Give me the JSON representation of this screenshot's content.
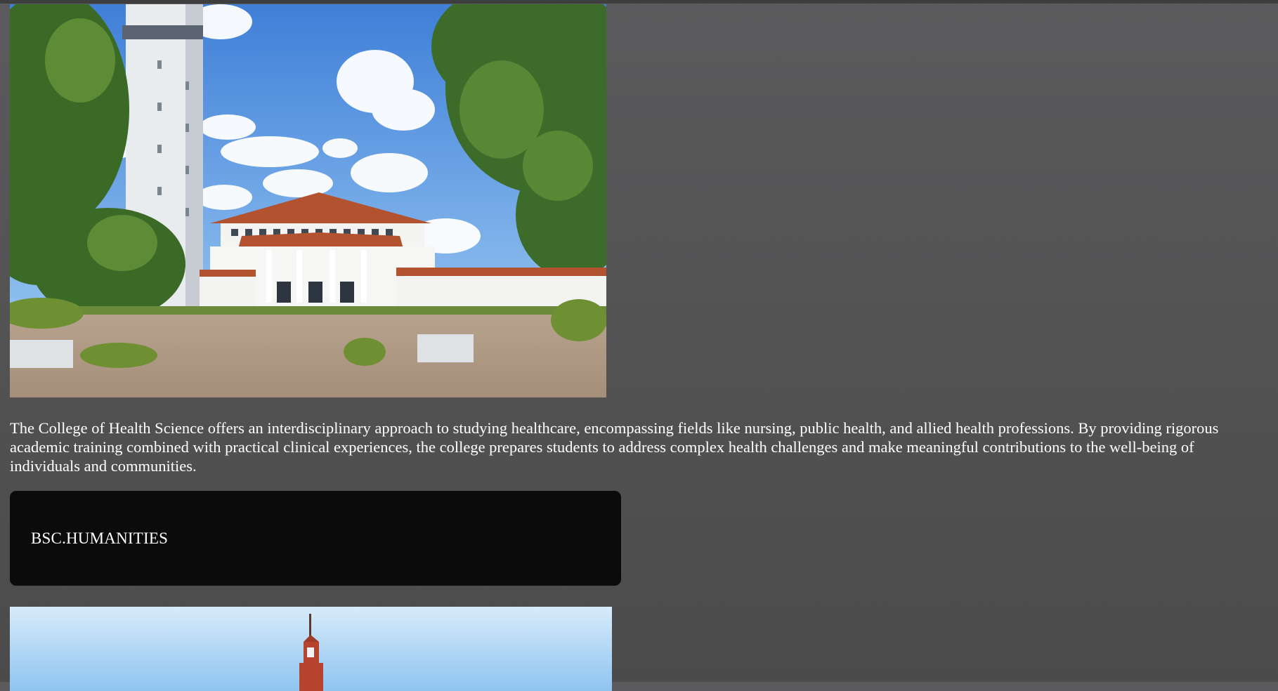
{
  "campus_photo": {
    "icon": "campus-building-photo"
  },
  "description": "The College of Health Science offers an interdisciplinary approach to studying healthcare, encompassing fields like nursing, public health, and allied health professions. By providing rigorous academic training combined with practical clinical experiences, the college prepares students to address complex health challenges and make meaningful contributions to the well-being of individuals and communities.",
  "program": {
    "label": "BSC.HUMANITIES"
  },
  "second_photo": {
    "icon": "clock-tower-photo"
  },
  "colors": {
    "background": "#555556",
    "card": "#0b0b0b",
    "text": "#ffffff"
  }
}
